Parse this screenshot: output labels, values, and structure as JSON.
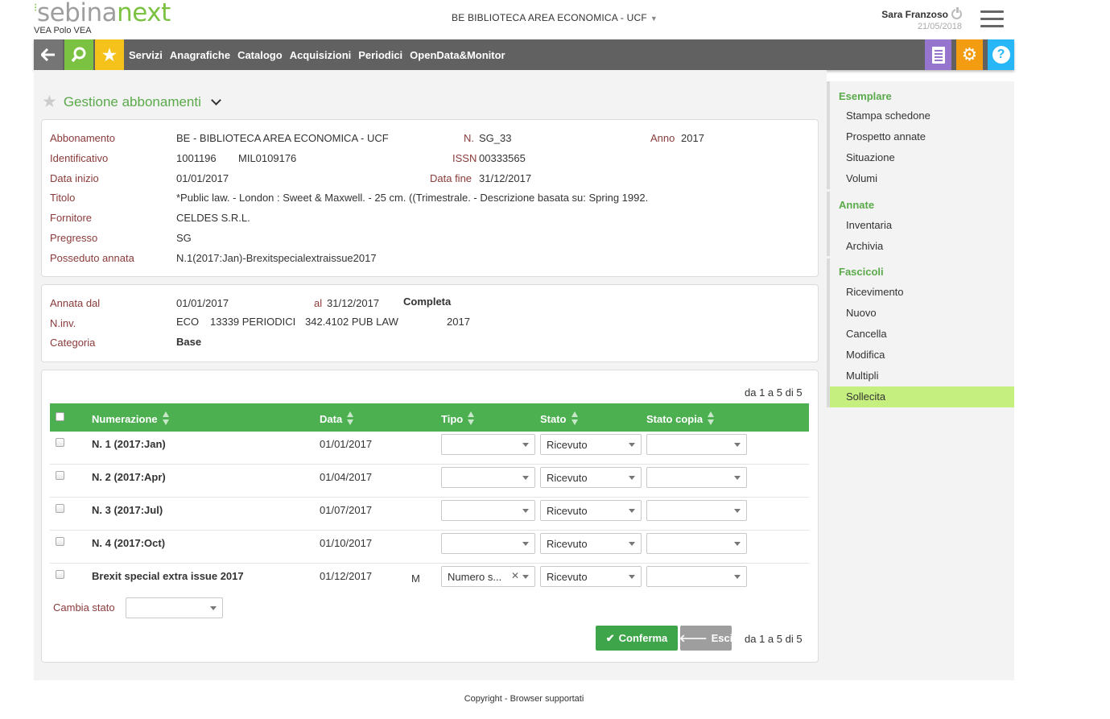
{
  "header": {
    "logo_prefix": "sebina",
    "logo_suffix": "next",
    "polo": "VEA Polo VEA",
    "library": "BE BIBLIOTECA AREA ECONOMICA - UCF",
    "user_name": "Sara Franzoso",
    "date": "21/05/2018"
  },
  "nav": {
    "items": [
      "Servizi",
      "Anagrafiche",
      "Catalogo",
      "Acquisizioni",
      "Periodici",
      "OpenData&Monitor"
    ]
  },
  "page": {
    "title": "Gestione abbonamenti"
  },
  "subscription": {
    "labels": {
      "abbonamento": "Abbonamento",
      "n": "N.",
      "anno": "Anno",
      "identificativo": "Identificativo",
      "issn": "ISSN",
      "data_inizio": "Data inizio",
      "data_fine": "Data fine",
      "titolo": "Titolo",
      "fornitore": "Fornitore",
      "pregresso": "Pregresso",
      "posseduto": "Posseduto annata"
    },
    "abbonamento": "BE -  BIBLIOTECA AREA ECONOMICA - UCF",
    "n": "SG_33",
    "anno": "2017",
    "identificativo": "1001196",
    "codice": "MIL0109176",
    "issn": "00333565",
    "data_inizio": "01/01/2017",
    "data_fine": "31/12/2017",
    "titolo": "*Public law. - London : Sweet & Maxwell. - 25 cm. ((Trimestrale. - Descrizione basata su: Spring 1992.",
    "fornitore": "CELDES S.R.L.",
    "pregresso": "SG",
    "posseduto": "N.1(2017:Jan)-Brexitspecialextraissue2017"
  },
  "annata": {
    "labels": {
      "dal": "Annata dal",
      "al": "al",
      "ninv": "N.inv.",
      "categoria": "Categoria"
    },
    "dal": "01/01/2017",
    "al": "31/12/2017",
    "stato": "Completa",
    "inv_prefix": "ECO",
    "inv_code": "13339 PERIODICI",
    "inv_collocazione": "342.4102 PUB LAW",
    "inv_anno": "2017",
    "categoria": "Base"
  },
  "table": {
    "pager": "da 1 a 5 di 5",
    "columns": {
      "numerazione": "Numerazione",
      "data": "Data",
      "tipo": "Tipo",
      "stato": "Stato",
      "stato_copia": "Stato copia"
    },
    "rows": [
      {
        "numerazione": "N. 1 (2017:Jan)",
        "data": "01/01/2017",
        "m": "",
        "tipo": "",
        "stato": "Ricevuto",
        "stato_copia": ""
      },
      {
        "numerazione": "N. 2 (2017:Apr)",
        "data": "01/04/2017",
        "m": "",
        "tipo": "",
        "stato": "Ricevuto",
        "stato_copia": ""
      },
      {
        "numerazione": "N. 3 (2017:Jul)",
        "data": "01/07/2017",
        "m": "",
        "tipo": "",
        "stato": "Ricevuto",
        "stato_copia": ""
      },
      {
        "numerazione": "N. 4 (2017:Oct)",
        "data": "01/10/2017",
        "m": "",
        "tipo": "",
        "stato": "Ricevuto",
        "stato_copia": ""
      },
      {
        "numerazione": "Brexit special extra issue 2017",
        "data": "01/12/2017",
        "m": "M",
        "tipo": "Numero s...",
        "stato": "Ricevuto",
        "stato_copia": ""
      }
    ],
    "cambia_stato": "Cambia stato",
    "confirm": "Conferma",
    "exit": "Esci"
  },
  "sidebar": {
    "groups": [
      {
        "title": "Esemplare",
        "items": [
          "Stampa schedone",
          "Prospetto annate",
          "Situazione",
          "Volumi"
        ]
      },
      {
        "title": "Annate",
        "items": [
          "Inventaria",
          "Archivia"
        ]
      },
      {
        "title": "Fascicoli",
        "items": [
          "Ricevimento",
          "Nuovo",
          "Cancella",
          "Modifica",
          "Multipli",
          "Sollecita"
        ]
      }
    ],
    "active": "Sollecita"
  },
  "footer": {
    "text": "Copyright - Browser supportati"
  },
  "colors": {
    "brand_green": "#7cc242",
    "table_header": "#4caf50",
    "active_item": "#c5f07f",
    "label_red": "#8b3a3a"
  }
}
